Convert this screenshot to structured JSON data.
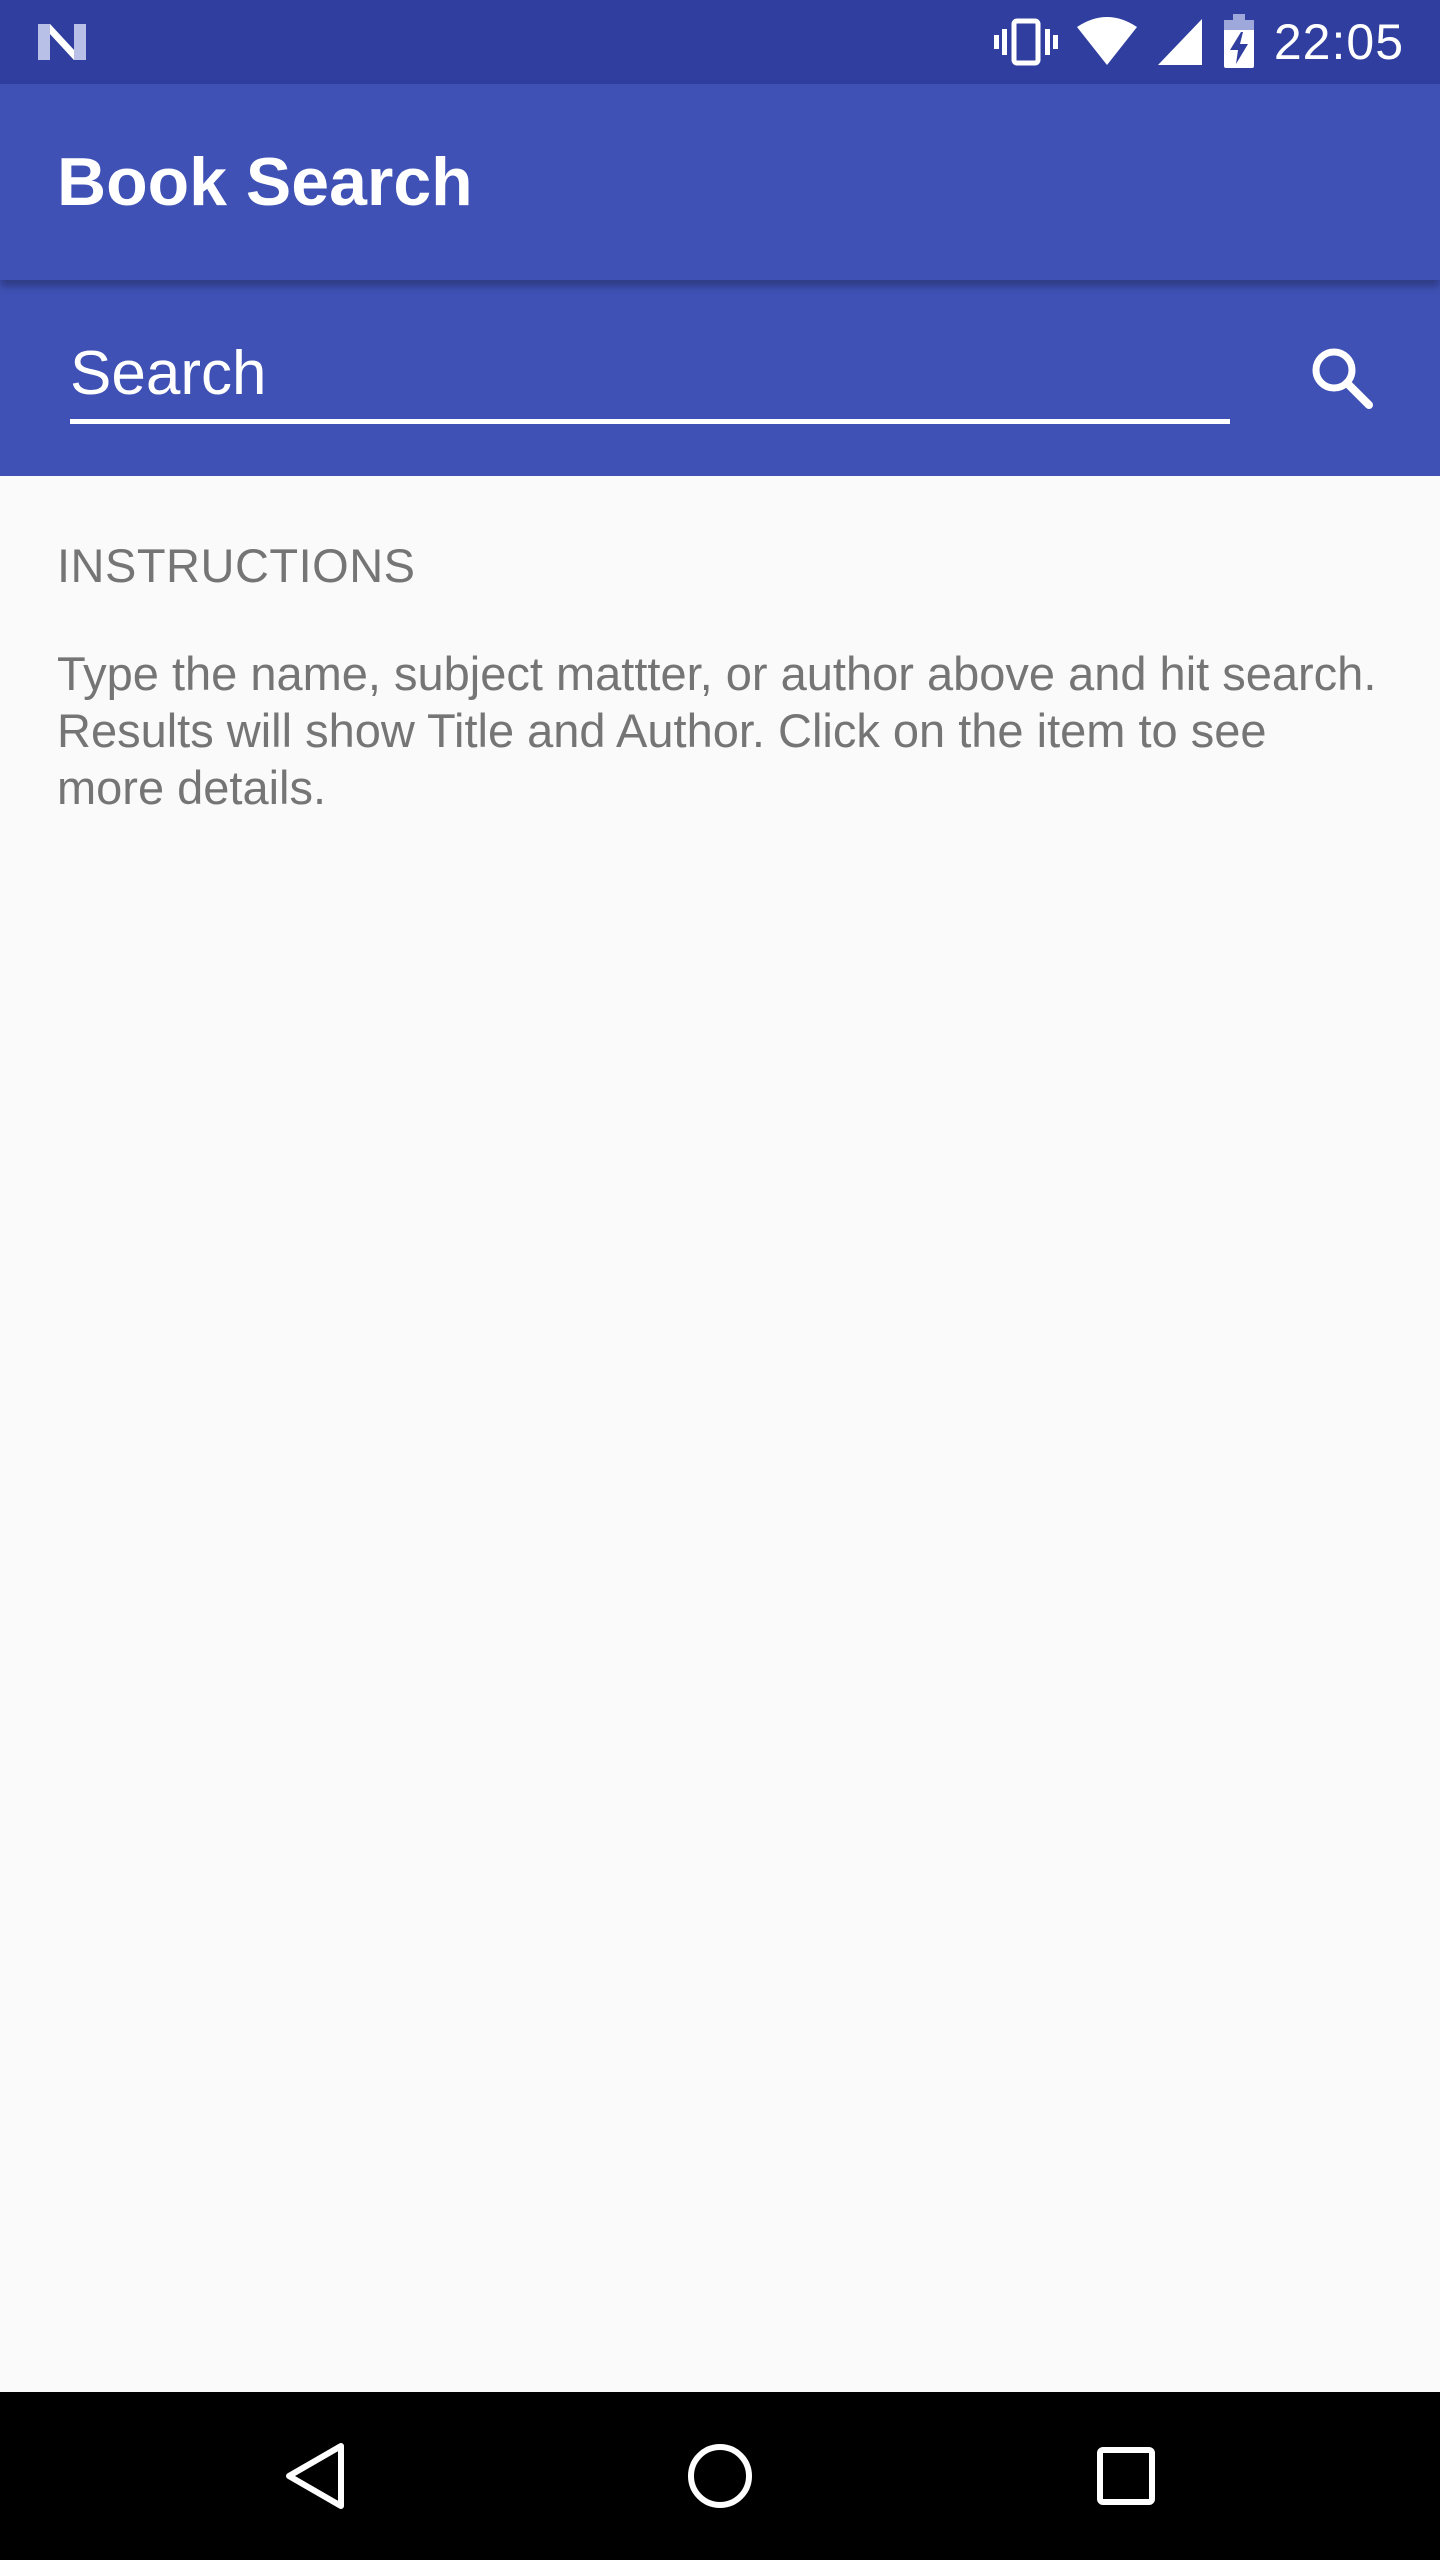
{
  "status_bar": {
    "time": "22:05",
    "icons": [
      "android-n-icon",
      "vibrate-icon",
      "wifi-icon",
      "cell-signal-icon",
      "battery-charging-icon"
    ],
    "color": "#303f9f"
  },
  "app_bar": {
    "title": "Book Search",
    "color": "#3f51b5"
  },
  "search": {
    "placeholder": "Search",
    "value": "",
    "button_icon": "search-icon"
  },
  "content": {
    "heading": "INSTRUCTIONS",
    "body": "Type the name, subject mattter, or author above and hit search. Results will show Title and Author. Click on the item to see more details."
  },
  "nav_bar": {
    "buttons": [
      "back-icon",
      "home-icon",
      "recents-icon"
    ]
  }
}
